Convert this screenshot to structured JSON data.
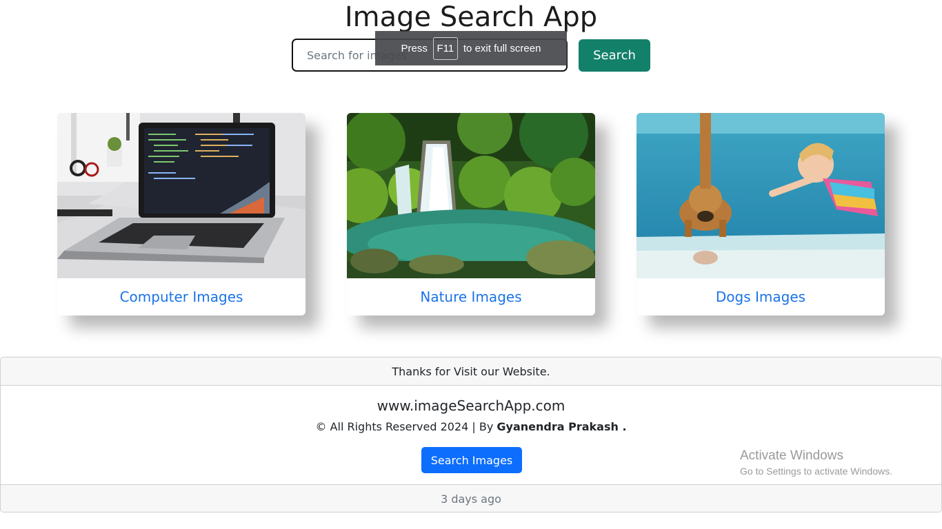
{
  "header": {
    "title": "Image Search App"
  },
  "search": {
    "placeholder": "Search for images",
    "button_label": "Search"
  },
  "fullscreen_notice": {
    "prefix": "Press",
    "key": "F11",
    "suffix": "to exit full screen"
  },
  "cards": [
    {
      "title": "Computer Images",
      "image": "laptop-photo"
    },
    {
      "title": "Nature Images",
      "image": "waterfall-photo"
    },
    {
      "title": "Dogs Images",
      "image": "dog-swimming-photo"
    }
  ],
  "footer": {
    "header_text": "Thanks for Visit our Website.",
    "site": "www.imageSearchApp.com",
    "rights_text": "© All Rights Reserved 2024 | By",
    "author": "Gyanendra Prakash .",
    "button_label": "Search Images",
    "timestamp": "3 days ago"
  },
  "watermark": {
    "title": "Activate Windows",
    "subtitle": "Go to Settings to activate Windows."
  },
  "colors": {
    "search_button": "#13806a",
    "card_title": "#1a73e8",
    "footer_button": "#0d6efd"
  }
}
